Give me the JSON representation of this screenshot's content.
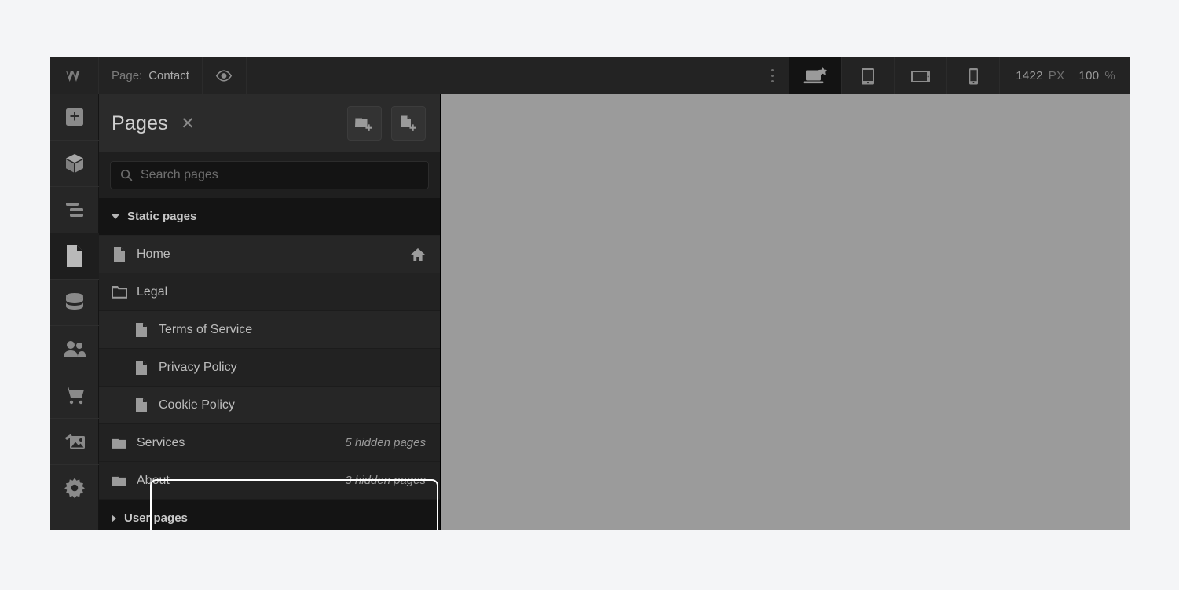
{
  "topbar": {
    "logo_icon": "webflow-logo-icon",
    "page_label": "Page:",
    "page_value": "Contact",
    "preview_icon": "eye-icon",
    "menu_icon": "kebab-menu-icon",
    "breakpoints": [
      {
        "name": "desktop-breakpoint",
        "icon": "laptop-star-icon",
        "selected": true
      },
      {
        "name": "tablet-breakpoint",
        "icon": "tablet-portrait-icon",
        "selected": false
      },
      {
        "name": "tablet-landscape-breakpoint",
        "icon": "tablet-landscape-icon",
        "selected": false
      },
      {
        "name": "mobile-breakpoint",
        "icon": "mobile-icon",
        "selected": false
      }
    ],
    "canvas_width": "1422",
    "canvas_width_unit": "PX",
    "zoom_value": "100",
    "zoom_unit": "%"
  },
  "rail": {
    "items": [
      {
        "name": "add-elements",
        "icon": "plus-square-icon",
        "active": false
      },
      {
        "name": "components",
        "icon": "cube-icon",
        "active": false
      },
      {
        "name": "navigator",
        "icon": "layers-icon",
        "active": false
      },
      {
        "name": "pages",
        "icon": "page-icon",
        "active": true
      },
      {
        "name": "cms",
        "icon": "database-icon",
        "active": false
      },
      {
        "name": "users",
        "icon": "people-icon",
        "active": false
      },
      {
        "name": "ecommerce",
        "icon": "shopping-cart-icon",
        "active": false
      },
      {
        "name": "assets",
        "icon": "images-icon",
        "active": false
      },
      {
        "name": "settings",
        "icon": "gear-icon",
        "active": false
      }
    ]
  },
  "panel": {
    "title": "Pages",
    "close_label": "✕",
    "new_folder_icon": "new-folder-icon",
    "new_page_icon": "new-page-icon",
    "search": {
      "placeholder": "Search pages",
      "value": "",
      "icon": "search-icon"
    },
    "sections": [
      {
        "label": "Static pages",
        "expanded": true
      },
      {
        "label": "User pages",
        "expanded": false
      }
    ],
    "pages": [
      {
        "name": "Home",
        "icon": "page-icon",
        "indent": 0,
        "meta": "",
        "badge": "home-icon"
      },
      {
        "name": "Legal",
        "icon": "folder-outline-icon",
        "indent": 0,
        "meta": "",
        "badge": ""
      },
      {
        "name": "Terms of Service",
        "icon": "page-icon",
        "indent": 1,
        "meta": "",
        "badge": ""
      },
      {
        "name": "Privacy Policy",
        "icon": "page-icon",
        "indent": 1,
        "meta": "",
        "badge": ""
      },
      {
        "name": "Cookie Policy",
        "icon": "page-icon",
        "indent": 1,
        "meta": "",
        "badge": ""
      },
      {
        "name": "Services",
        "icon": "folder-filled-icon",
        "indent": 0,
        "meta": "5 hidden pages",
        "badge": ""
      },
      {
        "name": "About",
        "icon": "folder-filled-icon",
        "indent": 0,
        "meta": "3 hidden pages",
        "badge": ""
      }
    ],
    "highlight_color": "#ffffff"
  },
  "canvas": {
    "background_color": "#9b9b9b"
  }
}
